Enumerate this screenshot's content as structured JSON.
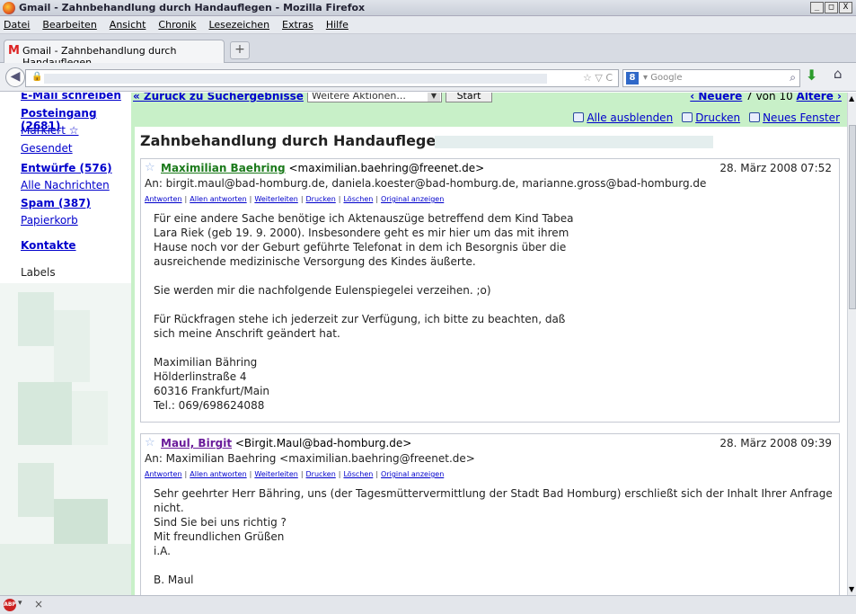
{
  "window": {
    "title": "Gmail - Zahnbehandlung durch Handauflegen - Mozilla Firefox",
    "min": "_",
    "max": "□",
    "close": "X"
  },
  "menu": [
    "Datei",
    "Bearbeiten",
    "Ansicht",
    "Chronik",
    "Lesezeichen",
    "Extras",
    "Hilfe"
  ],
  "tab": {
    "label": "Gmail - Zahnbehandlung durch Handauflegen",
    "newtab": "+"
  },
  "nav": {
    "search_placeholder": "Google",
    "search_engine": "8"
  },
  "sidebar": {
    "compose": "E-Mail schreiben",
    "items": [
      {
        "label": "Posteingang (2681)",
        "bold": true
      },
      {
        "label": "Markiert ☆",
        "bold": false
      },
      {
        "label": "Gesendet",
        "bold": false
      },
      {
        "label": "Entwürfe (576)",
        "bold": true
      },
      {
        "label": "Alle Nachrichten",
        "bold": false
      },
      {
        "label": "Spam (387)",
        "bold": true
      },
      {
        "label": "Papierkorb",
        "bold": false
      },
      {
        "label": "Kontakte",
        "bold": true
      }
    ],
    "labels_heading": "Labels"
  },
  "toolbar": {
    "back": "« Zurück zu Suchergebnisse",
    "more_actions": "Weitere Aktionen...",
    "start": "Start",
    "newer": "‹ Neuere",
    "range": " 7 von 10 ",
    "older": "Ältere ›",
    "hide_all": "Alle ausblenden",
    "print": "Drucken",
    "new_window": "Neues Fenster"
  },
  "thread": {
    "subject": "Zahnbehandlung durch Handauflegen",
    "action_labels": [
      "Antworten",
      "Allen antworten",
      "Weiterleiten",
      "Drucken",
      "Löschen",
      "Original anzeigen"
    ],
    "messages": [
      {
        "sender_name": "Maximilian Baehring",
        "sender_email": " <maximilian.baehring@freenet.de>",
        "date": "28. März 2008 07:52",
        "to": "An: birgit.maul@bad-homburg.de, daniela.koester@bad-homburg.de, marianne.gross@bad-homburg.de",
        "body": [
          [
            "Für eine andere Sache benötige ich Aktenauszüge betreffend dem Kind Tabea",
            "Lara Riek (geb 19. 9. 2000). Insbesondere geht es mir hier um das mit ihrem",
            "Hause noch vor der Geburt geführte Telefonat in dem ich Besorgnis über die",
            "ausreichende medizinische Versorgung des Kindes äußerte."
          ],
          [
            "Sie werden mir die nachfolgende Eulenspiegelei verzeihen. ;o)"
          ],
          [
            "Für Rückfragen stehe ich jederzeit zur Verfügung, ich bitte zu beachten, daß",
            "sich meine Anschrift geändert hat."
          ],
          [
            "Maximilian Bähring",
            "Hölderlinstraße 4",
            "60316 Frankfurt/Main",
            "Tel.: 069/698624088"
          ]
        ]
      },
      {
        "sender_name": "Maul, Birgit",
        "sender_email": " <Birgit.Maul@bad-homburg.de>",
        "date": "28. März 2008 09:39",
        "to": "An: Maximilian Baehring <maximilian.baehring@freenet.de>",
        "body": [
          [
            "Sehr geehrter Herr Bähring, uns (der Tagesmüttervermittlung der Stadt Bad Homburg) erschließt sich der Inhalt Ihrer Anfrage nicht.",
            "Sind Sie bei uns richtig ?",
            "Mit freundlichen Grüßen",
            "i.A."
          ],
          [
            "B. Maul"
          ]
        ]
      }
    ]
  },
  "status": {
    "close": "×"
  }
}
